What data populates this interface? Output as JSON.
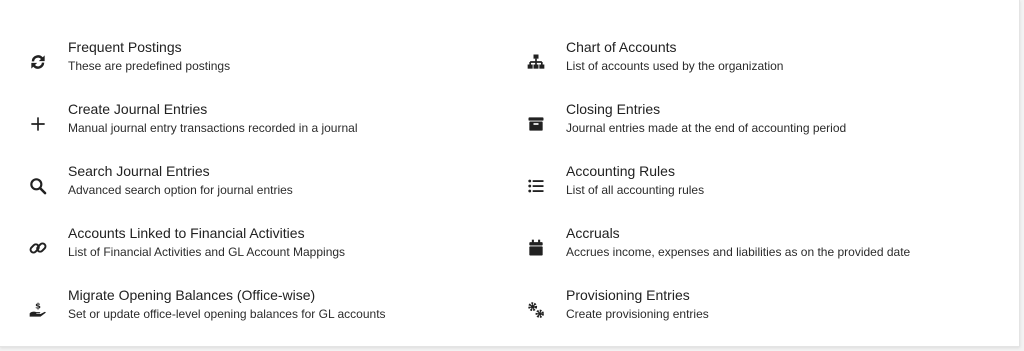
{
  "left_items": [
    {
      "icon": "refresh-icon",
      "title": "Frequent Postings",
      "desc": "These are predefined postings"
    },
    {
      "icon": "plus-icon",
      "title": "Create Journal Entries",
      "desc": "Manual journal entry transactions recorded in a journal"
    },
    {
      "icon": "search-icon",
      "title": "Search Journal Entries",
      "desc": "Advanced search option for journal entries"
    },
    {
      "icon": "link-icon",
      "title": "Accounts Linked to Financial Activities",
      "desc": "List of Financial Activities and GL Account Mappings"
    },
    {
      "icon": "hand-dollar-icon",
      "title": "Migrate Opening Balances (Office-wise)",
      "desc": "Set or update office-level opening balances for GL accounts"
    }
  ],
  "right_items": [
    {
      "icon": "sitemap-icon",
      "title": "Chart of Accounts",
      "desc": "List of accounts used by the organization"
    },
    {
      "icon": "archive-icon",
      "title": "Closing Entries",
      "desc": "Journal entries made at the end of accounting period"
    },
    {
      "icon": "list-icon",
      "title": "Accounting Rules",
      "desc": "List of all accounting rules"
    },
    {
      "icon": "calendar-icon",
      "title": "Accruals",
      "desc": "Accrues income, expenses and liabilities as on the provided date"
    },
    {
      "icon": "gears-icon",
      "title": "Provisioning Entries",
      "desc": "Create provisioning entries"
    }
  ],
  "colors": {
    "icon": "#212121",
    "text": "#212121",
    "background": "#ffffff"
  }
}
